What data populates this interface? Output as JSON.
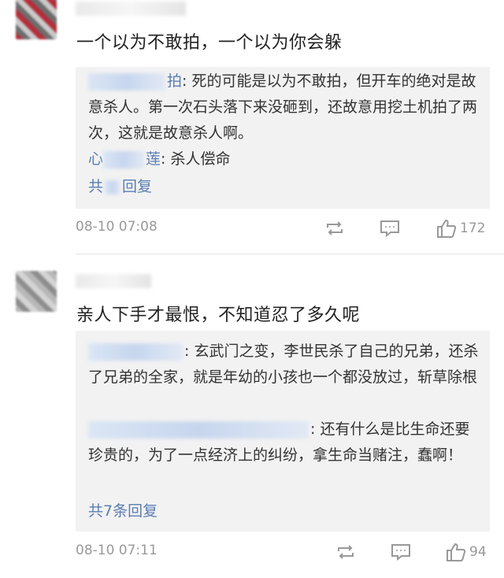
{
  "comments": [
    {
      "text": "一个以为不敢拍，一个以为你会躲",
      "replies": [
        {
          "name_tail": "拍",
          "text": ": 死的可能是以为不敢拍，但开车的绝对是故意杀人。第一次石头落下来没砸到，还故意用挖土机拍了两次，这就是故意杀人啊。"
        },
        {
          "name_head": "心",
          "name_tail": "莲",
          "text": ": 杀人偿命"
        }
      ],
      "total_replies_prefix": "共",
      "total_replies_suffix": "回复",
      "time": "08-10 07:08",
      "likes": "172",
      "icons": {
        "repost": "repost-icon",
        "comment": "comment-icon",
        "like": "thumbs-up-icon"
      }
    },
    {
      "text": "亲人下手才最恨，不知道忍了多久呢",
      "replies": [
        {
          "name_tail": "",
          "text": ": 玄武门之变，李世民杀了自己的兄弟，还杀了兄弟的全家，就是年幼的小孩也一个都没放过，斩草除根"
        },
        {
          "name_tail": "",
          "text": ": 还有什么是比生命还要珍贵的，为了一点经济上的纠纷，拿生命当赌注，蠢啊！"
        }
      ],
      "total_replies": "共7条回复",
      "time": "08-10 07:11",
      "likes": "94",
      "icons": {
        "repost": "repost-icon",
        "comment": "comment-icon",
        "like": "thumbs-up-icon"
      }
    }
  ],
  "colors": {
    "link": "#5b7db3",
    "meta": "#999999",
    "reply_bg": "#f2f2f2"
  }
}
